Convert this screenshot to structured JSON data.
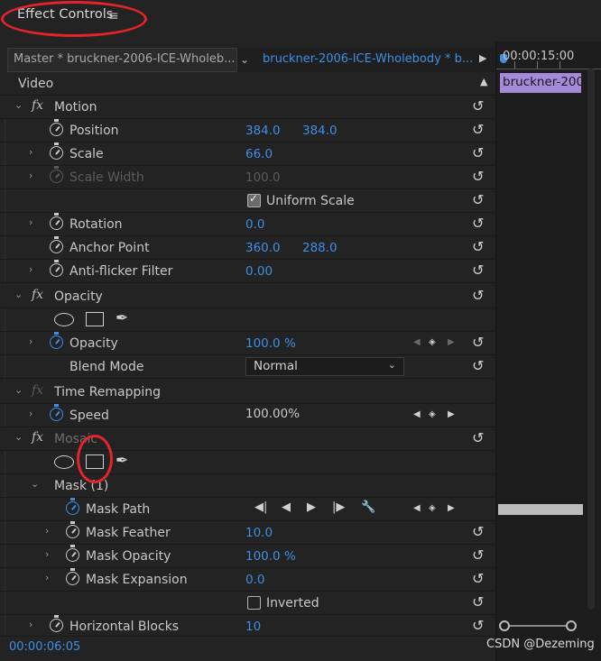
{
  "header": {
    "title": "Effect Controls",
    "menu_icon": "≡"
  },
  "clip_row": {
    "master": "Master * bruckner-2006-ICE-Wholeb...",
    "sequence": "bruckner-2006-ICE-Wholebody * b..."
  },
  "timeline": {
    "time": "00:00:15:00",
    "clip_name": "bruckner-200"
  },
  "video_label": "Video",
  "motion": {
    "name": "Motion",
    "position": {
      "label": "Position",
      "x": "384.0",
      "y": "384.0"
    },
    "scale": {
      "label": "Scale",
      "value": "66.0"
    },
    "scale_width": {
      "label": "Scale Width",
      "value": "100.0"
    },
    "uniform_scale": {
      "label": "Uniform Scale",
      "checked": true
    },
    "rotation": {
      "label": "Rotation",
      "value": "0.0"
    },
    "anchor_point": {
      "label": "Anchor Point",
      "x": "360.0",
      "y": "288.0"
    },
    "anti_flicker": {
      "label": "Anti-flicker Filter",
      "value": "0.00"
    }
  },
  "opacity": {
    "name": "Opacity",
    "opacity": {
      "label": "Opacity",
      "value": "100.0 %"
    },
    "blend_mode": {
      "label": "Blend Mode",
      "value": "Normal"
    }
  },
  "time_remapping": {
    "name": "Time Remapping",
    "speed": {
      "label": "Speed",
      "value": "100.00%"
    }
  },
  "mosaic": {
    "name": "Mosaic",
    "mask": {
      "name": "Mask (1)",
      "mask_path": {
        "label": "Mask Path"
      },
      "mask_feather": {
        "label": "Mask Feather",
        "value": "10.0"
      },
      "mask_opacity": {
        "label": "Mask Opacity",
        "value": "100.0 %"
      },
      "mask_expansion": {
        "label": "Mask Expansion",
        "value": "0.0"
      },
      "inverted": {
        "label": "Inverted",
        "checked": false
      }
    },
    "horizontal_blocks": {
      "label": "Horizontal Blocks",
      "value": "10"
    }
  },
  "footer": {
    "current_time": "00:00:06:05"
  },
  "watermark": "CSDN @Dezeming",
  "colors": {
    "accent": "#3d8fe6",
    "clip": "#a48ad9",
    "annotation": "#e3242b"
  }
}
